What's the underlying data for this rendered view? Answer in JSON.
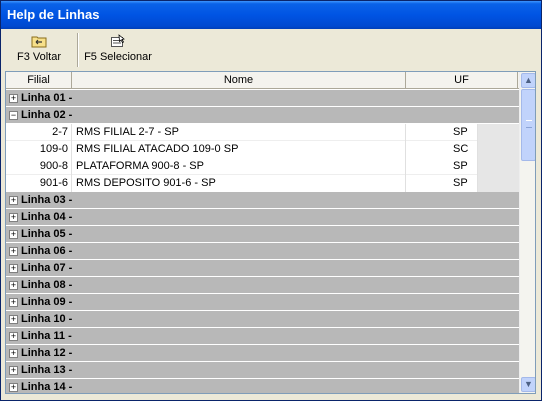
{
  "window": {
    "title": "Help de Linhas"
  },
  "toolbar": {
    "voltar_label": "F3 Voltar",
    "selecionar_label": "F5 Selecionar"
  },
  "grid": {
    "columns": [
      "Filial",
      "Nome",
      "UF"
    ],
    "groups": [
      {
        "label": "Linha 01 -",
        "expanded": false
      },
      {
        "label": "Linha 02 -",
        "expanded": true,
        "rows": [
          {
            "filial": "2-7",
            "nome": "RMS FILIAL 2-7 - SP",
            "uf": "SP"
          },
          {
            "filial": "109-0",
            "nome": "RMS FILIAL ATACADO 109-0 SP",
            "uf": "SC"
          },
          {
            "filial": "900-8",
            "nome": "PLATAFORMA 900-8 - SP",
            "uf": "SP"
          },
          {
            "filial": "901-6",
            "nome": "RMS DEPOSITO 901-6 - SP",
            "uf": "SP"
          }
        ]
      },
      {
        "label": "Linha 03 -",
        "expanded": false
      },
      {
        "label": "Linha 04 -",
        "expanded": false
      },
      {
        "label": "Linha 05 -",
        "expanded": false
      },
      {
        "label": "Linha 06 -",
        "expanded": false
      },
      {
        "label": "Linha 07 -",
        "expanded": false
      },
      {
        "label": "Linha 08 -",
        "expanded": false
      },
      {
        "label": "Linha 09 -",
        "expanded": false
      },
      {
        "label": "Linha 10 -",
        "expanded": false
      },
      {
        "label": "Linha 11 -",
        "expanded": false
      },
      {
        "label": "Linha 12 -",
        "expanded": false
      },
      {
        "label": "Linha 13 -",
        "expanded": false
      },
      {
        "label": "Linha 14 -",
        "expanded": false
      }
    ]
  },
  "icons": {
    "voltar": "folder-back-icon",
    "selecionar": "select-icon",
    "expand": "plus-icon",
    "collapse": "minus-icon",
    "scroll_up": "chevron-up-icon",
    "scroll_down": "chevron-down-icon"
  },
  "colors": {
    "titlebar": "#0054e3",
    "group_row": "#b8b8b8",
    "window_bg": "#ece9d8"
  }
}
